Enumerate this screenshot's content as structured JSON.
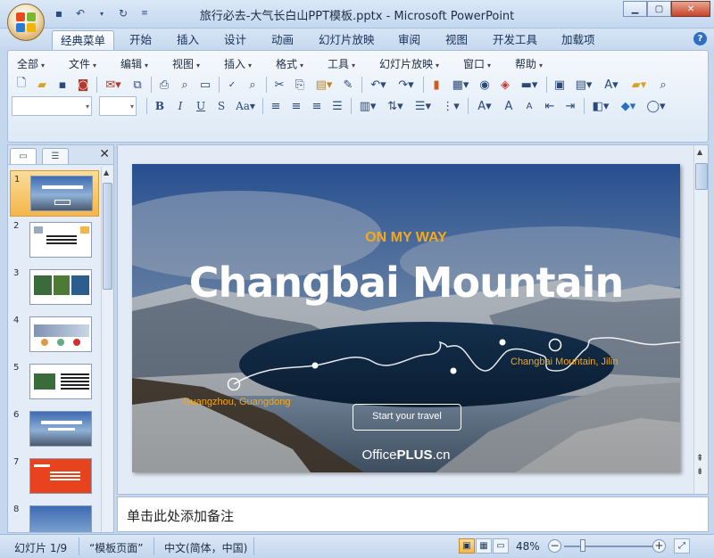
{
  "window": {
    "title": "旅行必去-大气长白山PPT模板.pptx - Microsoft PowerPoint"
  },
  "ribbon_tabs": [
    "经典菜单",
    "开始",
    "插入",
    "设计",
    "动画",
    "幻灯片放映",
    "审阅",
    "视图",
    "开发工具",
    "加载项"
  ],
  "menu": [
    "全部",
    "文件",
    "编辑",
    "视图",
    "插入",
    "格式",
    "工具",
    "幻灯片放映",
    "窗口",
    "帮助"
  ],
  "slide": {
    "tagline": "ON MY WAY",
    "title": "Changbai Mountain",
    "from_label": "Guangzhou, Guangdong",
    "to_label": "Changbai Mountain, Jilin",
    "button": "Start your travel",
    "brand_a": "Office",
    "brand_b": "PLUS",
    "brand_c": ".cn"
  },
  "thumbnails": [
    "1",
    "2",
    "3",
    "4",
    "5",
    "6",
    "7",
    "8"
  ],
  "notes_placeholder": "单击此处添加备注",
  "status": {
    "slide_info": "幻灯片 1/9",
    "theme": "“模板页面”",
    "language": "中文(简体，中国)",
    "zoom": "48%"
  },
  "colors": {
    "accent_orange": "#f4a81d",
    "ribbon_blue": "#c5d7ec",
    "selected_thumb": "#f4b64a"
  }
}
